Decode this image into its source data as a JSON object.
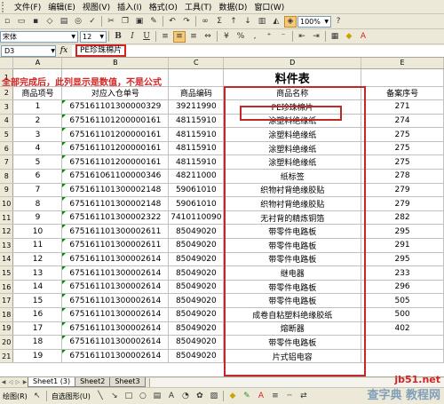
{
  "menu": [
    "文件(F)",
    "编辑(E)",
    "视图(V)",
    "插入(I)",
    "格式(O)",
    "工具(T)",
    "数据(D)",
    "窗口(W)"
  ],
  "toolbar": {
    "zoom": "100%",
    "font": "宋体",
    "font_size": "12"
  },
  "namebox": "D3",
  "formula": "PE珍珠棉片",
  "columns": [
    "A",
    "B",
    "C",
    "D",
    "E"
  ],
  "annotation": "全部完成后，此列显示是数值，不是公式",
  "sheet_title": "料件表",
  "headers": [
    "商品项号",
    "对应入仓单号",
    "商品编码",
    "商品名称",
    "备案序号"
  ],
  "rows": [
    {
      "r": "3",
      "a": "1",
      "b": "675161101300000329",
      "c": "39211990",
      "d": "PE珍珠棉片",
      "e": "271"
    },
    {
      "r": "4",
      "a": "2",
      "b": "675161101200000161",
      "c": "48115910",
      "d": "涂塑料绝缘纸",
      "e": "274"
    },
    {
      "r": "5",
      "a": "3",
      "b": "675161101200000161",
      "c": "48115910",
      "d": "涂塑料绝缘纸",
      "e": "275"
    },
    {
      "r": "6",
      "a": "4",
      "b": "675161101200000161",
      "c": "48115910",
      "d": "涂塑料绝缘纸",
      "e": "275"
    },
    {
      "r": "7",
      "a": "5",
      "b": "675161101200000161",
      "c": "48115910",
      "d": "涂塑料绝缘纸",
      "e": "275"
    },
    {
      "r": "8",
      "a": "6",
      "b": "675161061100000346",
      "c": "48211000",
      "d": "纸标签",
      "e": "278"
    },
    {
      "r": "9",
      "a": "7",
      "b": "675161101300002148",
      "c": "59061010",
      "d": "织物衬背绝缘胶贴",
      "e": "279"
    },
    {
      "r": "10",
      "a": "8",
      "b": "675161101300002148",
      "c": "59061010",
      "d": "织物衬背绝缘胶贴",
      "e": "279"
    },
    {
      "r": "11",
      "a": "9",
      "b": "675161101300002322",
      "c": "7410110090",
      "d": "无衬背的精炼铜箔",
      "e": "282"
    },
    {
      "r": "12",
      "a": "10",
      "b": "675161101300002611",
      "c": "85049020",
      "d": "带零件电路板",
      "e": "295"
    },
    {
      "r": "13",
      "a": "11",
      "b": "675161101300002611",
      "c": "85049020",
      "d": "带零件电路板",
      "e": "291"
    },
    {
      "r": "14",
      "a": "12",
      "b": "675161101300002614",
      "c": "85049020",
      "d": "带零件电路板",
      "e": "295"
    },
    {
      "r": "15",
      "a": "13",
      "b": "675161101300002614",
      "c": "85049020",
      "d": "继电器",
      "e": "233"
    },
    {
      "r": "16",
      "a": "14",
      "b": "675161101300002614",
      "c": "85049020",
      "d": "带零件电路板",
      "e": "296"
    },
    {
      "r": "17",
      "a": "15",
      "b": "675161101300002614",
      "c": "85049020",
      "d": "带零件电路板",
      "e": "505"
    },
    {
      "r": "18",
      "a": "16",
      "b": "675161101300002614",
      "c": "85049020",
      "d": "成卷自粘塑料绝缘胶纸",
      "e": "500"
    },
    {
      "r": "19",
      "a": "17",
      "b": "675161101300002614",
      "c": "85049020",
      "d": "熔断器",
      "e": "402"
    },
    {
      "r": "20",
      "a": "18",
      "b": "675161101300002614",
      "c": "85049020",
      "d": "带零件电路板",
      "e": ""
    },
    {
      "r": "21",
      "a": "19",
      "b": "675161101300002614",
      "c": "85049020",
      "d": "片式铝电容",
      "e": ""
    }
  ],
  "tabs": [
    "Sheet1 (3)",
    "Sheet2",
    "Sheet3"
  ],
  "drawbar": {
    "draw": "绘图(R)",
    "autoshape": "自选图形(U)"
  },
  "watermark": {
    "url": "jb51.net",
    "brand": "查字典 教程网"
  },
  "colors": {
    "accent_red": "#d32424",
    "chrome": "#ece9d8"
  }
}
